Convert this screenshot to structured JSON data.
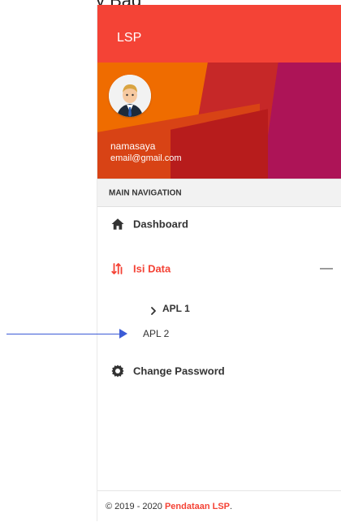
{
  "top_caption": "y Bag",
  "app": {
    "brand": "LSP"
  },
  "user": {
    "name": "namasaya",
    "email": "email@gmail.com"
  },
  "nav": {
    "section_title": "MAIN NAVIGATION",
    "items": [
      {
        "label": "Dashboard",
        "icon": "home-icon"
      },
      {
        "label": "Isi Data",
        "icon": "swap-icon",
        "active": true,
        "expanded": true,
        "children": [
          {
            "label": "APL 1",
            "selected": true
          },
          {
            "label": "APL 2"
          }
        ]
      },
      {
        "label": "Change Password",
        "icon": "gear-icon"
      }
    ]
  },
  "footer": {
    "prefix": "© 2019 - 2020 ",
    "link": "Pendataan LSP",
    "suffix": "."
  },
  "colors": {
    "primary": "#f44336",
    "text": "#333333",
    "annotation": "#3b5bd6"
  }
}
